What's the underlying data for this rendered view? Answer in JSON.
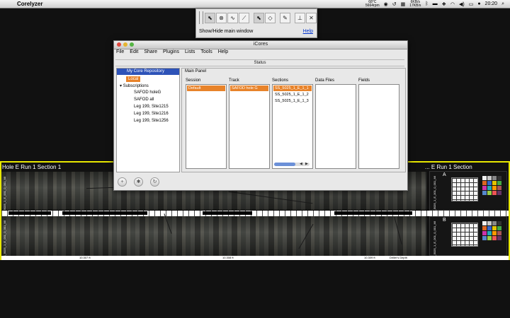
{
  "menubar": {
    "apple": "",
    "app_name": "Corelyzer",
    "temp_top": "68°C",
    "temp_bottom": "5664rpm",
    "net_top": "6KB/s",
    "net_bottom": "17KB/s",
    "clock": "20:20"
  },
  "toolbar": {
    "show_hide_label": "Show/Hide main window",
    "help_label": "Help",
    "tools": [
      "⬉",
      "⊗",
      "∿",
      "⟋",
      "⬉",
      "◇",
      "✎",
      "⊥",
      "✕"
    ]
  },
  "strip": {
    "title": "Hole E Run 1 Section 1",
    "title_right": "... E Run 1 Section",
    "depth_1": "SS_5025_1_E_001_0_001_MI",
    "depth_2": "SS_5025_1_E_001_0_001_MI",
    "card_a": "A",
    "card_b": "B",
    "card_label_1": "SS_5025_1_E_001_0_001_MI",
    "card_label_2": "SS_5025_1_E_001_0_001_MI",
    "axis_1": "10.307 ft",
    "axis_2": "10.308 ft",
    "axis_3": "10.309 ft",
    "axis_4": "Driller's Depth"
  },
  "icores": {
    "title": "iCores",
    "menu": [
      "File",
      "Edit",
      "Share",
      "Plugins",
      "Lists",
      "Tools",
      "Help"
    ],
    "status": "Status",
    "tree": {
      "header": "My Core Repository",
      "local": "Local",
      "subscriptions": "Subscriptions",
      "items": [
        "SAFOD holeG",
        "SAFOD all",
        "Leg 199, Site1215",
        "Leg 199, Site1216",
        "Leg 199, Site1256"
      ]
    },
    "main_panel": "Main Panel",
    "columns": {
      "session": {
        "label": "Session",
        "selected": "Default"
      },
      "track": {
        "label": "Track",
        "selected": "SAFOD hole G"
      },
      "sections": {
        "label": "Sections",
        "selected": "SS_5025_1_E_1_1",
        "entries": [
          "SS_5025_1_E_1_2",
          "SS_5025_1_E_1_3"
        ]
      },
      "data_files": {
        "label": "Data Files"
      },
      "fields": {
        "label": "Fields"
      }
    }
  },
  "colors": {
    "accent": "#e8832a",
    "header_blue": "#2e53b8",
    "strip_border": "#e8e800"
  }
}
